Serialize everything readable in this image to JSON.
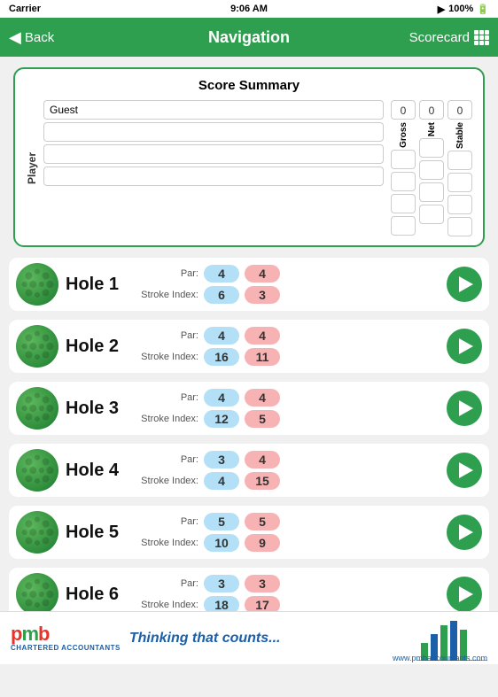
{
  "statusBar": {
    "carrier": "Carrier",
    "time": "9:06 AM",
    "signal": "100%"
  },
  "navBar": {
    "backLabel": "Back",
    "title": "Navigation",
    "scorecardLabel": "Scorecard"
  },
  "scoreSummary": {
    "title": "Score Summary",
    "playerLabel": "Player",
    "players": [
      {
        "name": "Guest",
        "placeholder": ""
      },
      {
        "name": "",
        "placeholder": ""
      },
      {
        "name": "",
        "placeholder": ""
      },
      {
        "name": "",
        "placeholder": ""
      }
    ],
    "columns": [
      "Gross",
      "Net",
      "Stable"
    ],
    "topValues": [
      "0",
      "0",
      "0"
    ]
  },
  "holes": [
    {
      "id": 1,
      "name": "Hole 1",
      "par": 4,
      "strokeIndex": 6,
      "parRight": 4,
      "strokeIndexRight": 3
    },
    {
      "id": 2,
      "name": "Hole 2",
      "par": 4,
      "strokeIndex": 16,
      "parRight": 4,
      "strokeIndexRight": 11
    },
    {
      "id": 3,
      "name": "Hole 3",
      "par": 4,
      "strokeIndex": 12,
      "parRight": 4,
      "strokeIndexRight": 5
    },
    {
      "id": 4,
      "name": "Hole 4",
      "par": 3,
      "strokeIndex": 4,
      "parRight": 4,
      "strokeIndexRight": 15
    },
    {
      "id": 5,
      "name": "Hole 5",
      "par": 5,
      "strokeIndex": 10,
      "parRight": 5,
      "strokeIndexRight": 9
    },
    {
      "id": 6,
      "name": "Hole 6",
      "par": 3,
      "strokeIndex": 18,
      "parRight": 3,
      "strokeIndexRight": 17
    }
  ],
  "ad": {
    "logoText": "pmb",
    "subText": "Chartered Accountants",
    "tagline": "Thinking that counts...",
    "website": "www.pmbaccountants.com"
  }
}
